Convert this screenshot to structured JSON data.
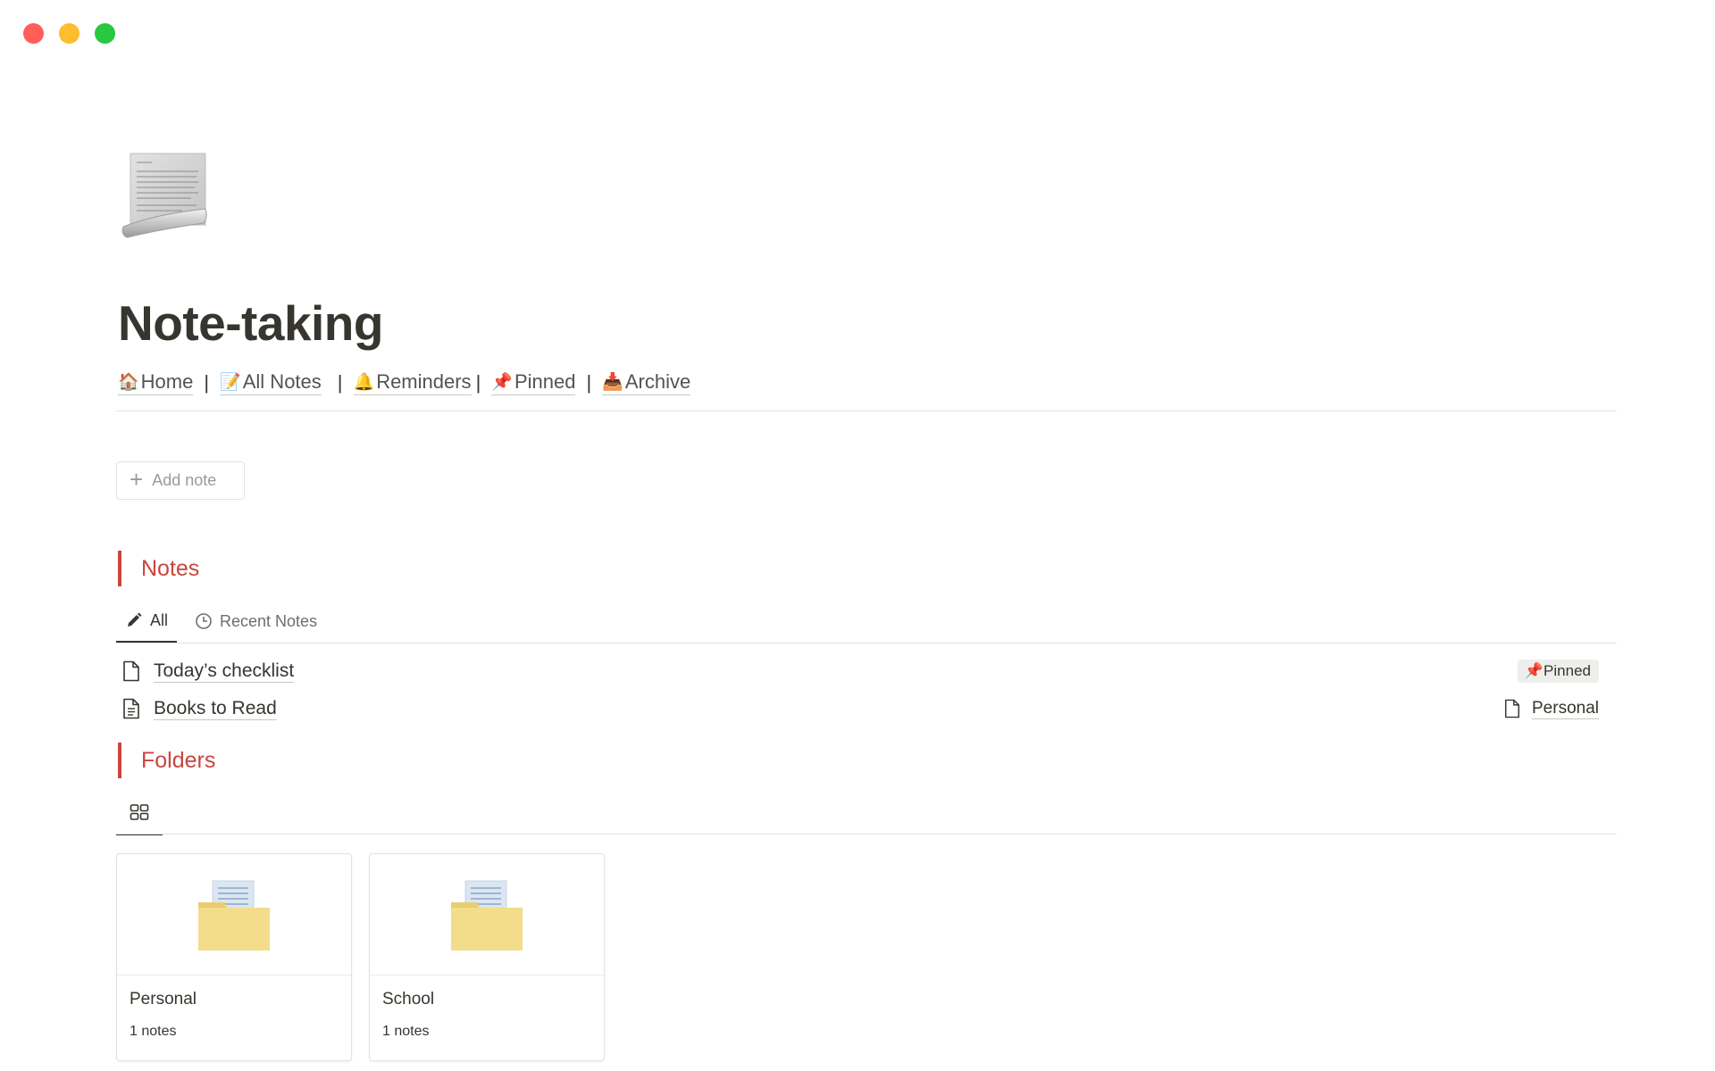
{
  "window": {
    "controls": [
      {
        "name": "close",
        "color": "#ff5f57"
      },
      {
        "name": "minimize",
        "color": "#febc2e"
      },
      {
        "name": "maximize",
        "color": "#28c840"
      }
    ]
  },
  "page": {
    "icon": "scroll-icon",
    "title": "Note-taking"
  },
  "nav": {
    "items": [
      {
        "emoji": "🏠",
        "label": "Home"
      },
      {
        "emoji": "📝",
        "label": "All Notes"
      },
      {
        "emoji": "🔔",
        "label": "Reminders"
      },
      {
        "emoji": "📌",
        "label": "Pinned"
      },
      {
        "emoji": "📥",
        "label": "Archive"
      }
    ],
    "separator": "|"
  },
  "add_note": {
    "label": "Add note"
  },
  "notes_section": {
    "heading": "Notes",
    "accent_color": "#c9463d",
    "tabs": [
      {
        "label": "All",
        "icon": "pencil-icon",
        "active": true
      },
      {
        "label": "Recent Notes",
        "icon": "clock-icon",
        "active": false
      }
    ],
    "rows": [
      {
        "title": "Today’s checklist",
        "tag": "📌Pinned"
      },
      {
        "title": "Books to Read",
        "folder": "Personal"
      }
    ]
  },
  "folders_section": {
    "heading": "Folders",
    "view_icon": "gallery-grid-icon",
    "cards": [
      {
        "title": "Personal",
        "count": "1 notes",
        "cover_icon": "folder-icon"
      },
      {
        "title": "School",
        "count": "1 notes",
        "cover_icon": "folder-icon"
      }
    ]
  }
}
